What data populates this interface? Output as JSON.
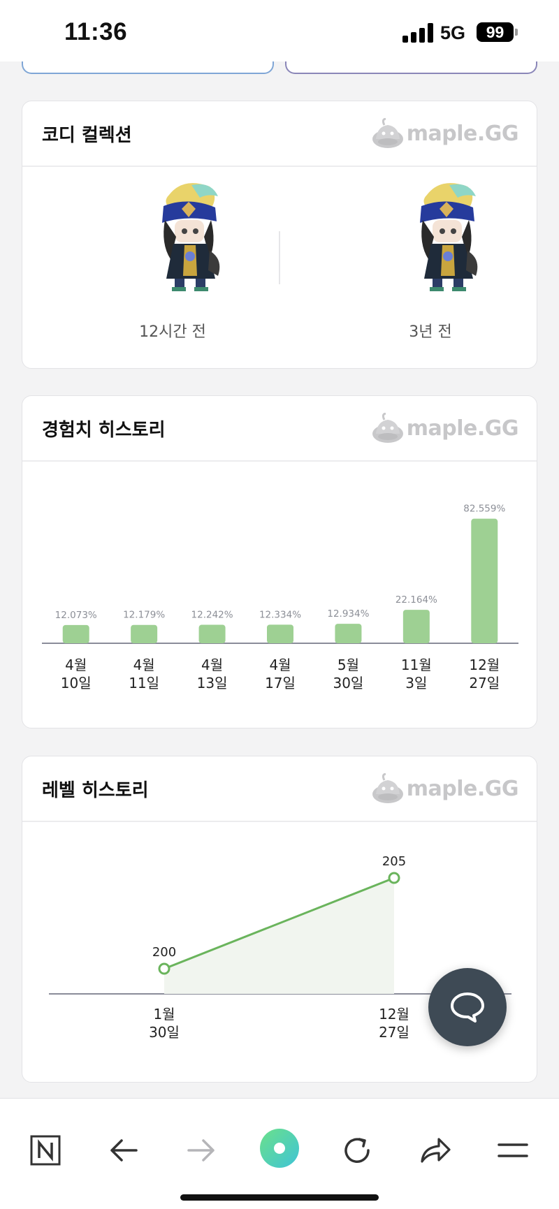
{
  "status_bar": {
    "time": "11:36",
    "network": "5G",
    "battery": "99"
  },
  "coordi": {
    "title": "코디 컬렉션",
    "brand": "maple.GG",
    "items": [
      {
        "caption": "12시간 전",
        "icon": "character-avatar-icon"
      },
      {
        "caption": "3년 전",
        "icon": "character-avatar-icon"
      }
    ]
  },
  "exp_history": {
    "title": "경험치 히스토리",
    "brand": "maple.GG"
  },
  "level_history": {
    "title": "레벨 히스토리",
    "brand": "maple.GG"
  },
  "chart_data": [
    {
      "type": "bar",
      "categories": [
        [
          "4월",
          "10일"
        ],
        [
          "4월",
          "11일"
        ],
        [
          "4월",
          "13일"
        ],
        [
          "4월",
          "17일"
        ],
        [
          "5월",
          "30일"
        ],
        [
          "11월",
          "3일"
        ],
        [
          "12월",
          "27일"
        ]
      ],
      "values": [
        12.073,
        12.179,
        12.242,
        12.334,
        12.934,
        22.164,
        82.559
      ],
      "labels": [
        "12.073%",
        "12.179%",
        "12.242%",
        "12.334%",
        "12.934%",
        "22.164%",
        "82.559%"
      ],
      "ylim": [
        0,
        100
      ],
      "color": "#9ed093"
    },
    {
      "type": "area",
      "categories": [
        [
          "1월",
          "30일"
        ],
        [
          "12월",
          "27일"
        ]
      ],
      "values": [
        200,
        205
      ],
      "labels": [
        "200",
        "205"
      ],
      "color": "#6ab45c"
    }
  ],
  "fab": {
    "icon": "chat-bubble-icon"
  },
  "toolbar": {
    "buttons": [
      {
        "icon": "naver-n-icon"
      },
      {
        "icon": "back-arrow-icon"
      },
      {
        "icon": "forward-arrow-icon"
      },
      {
        "icon": "green-dot-icon"
      },
      {
        "icon": "reload-icon"
      },
      {
        "icon": "share-icon"
      },
      {
        "icon": "menu-icon"
      }
    ]
  }
}
